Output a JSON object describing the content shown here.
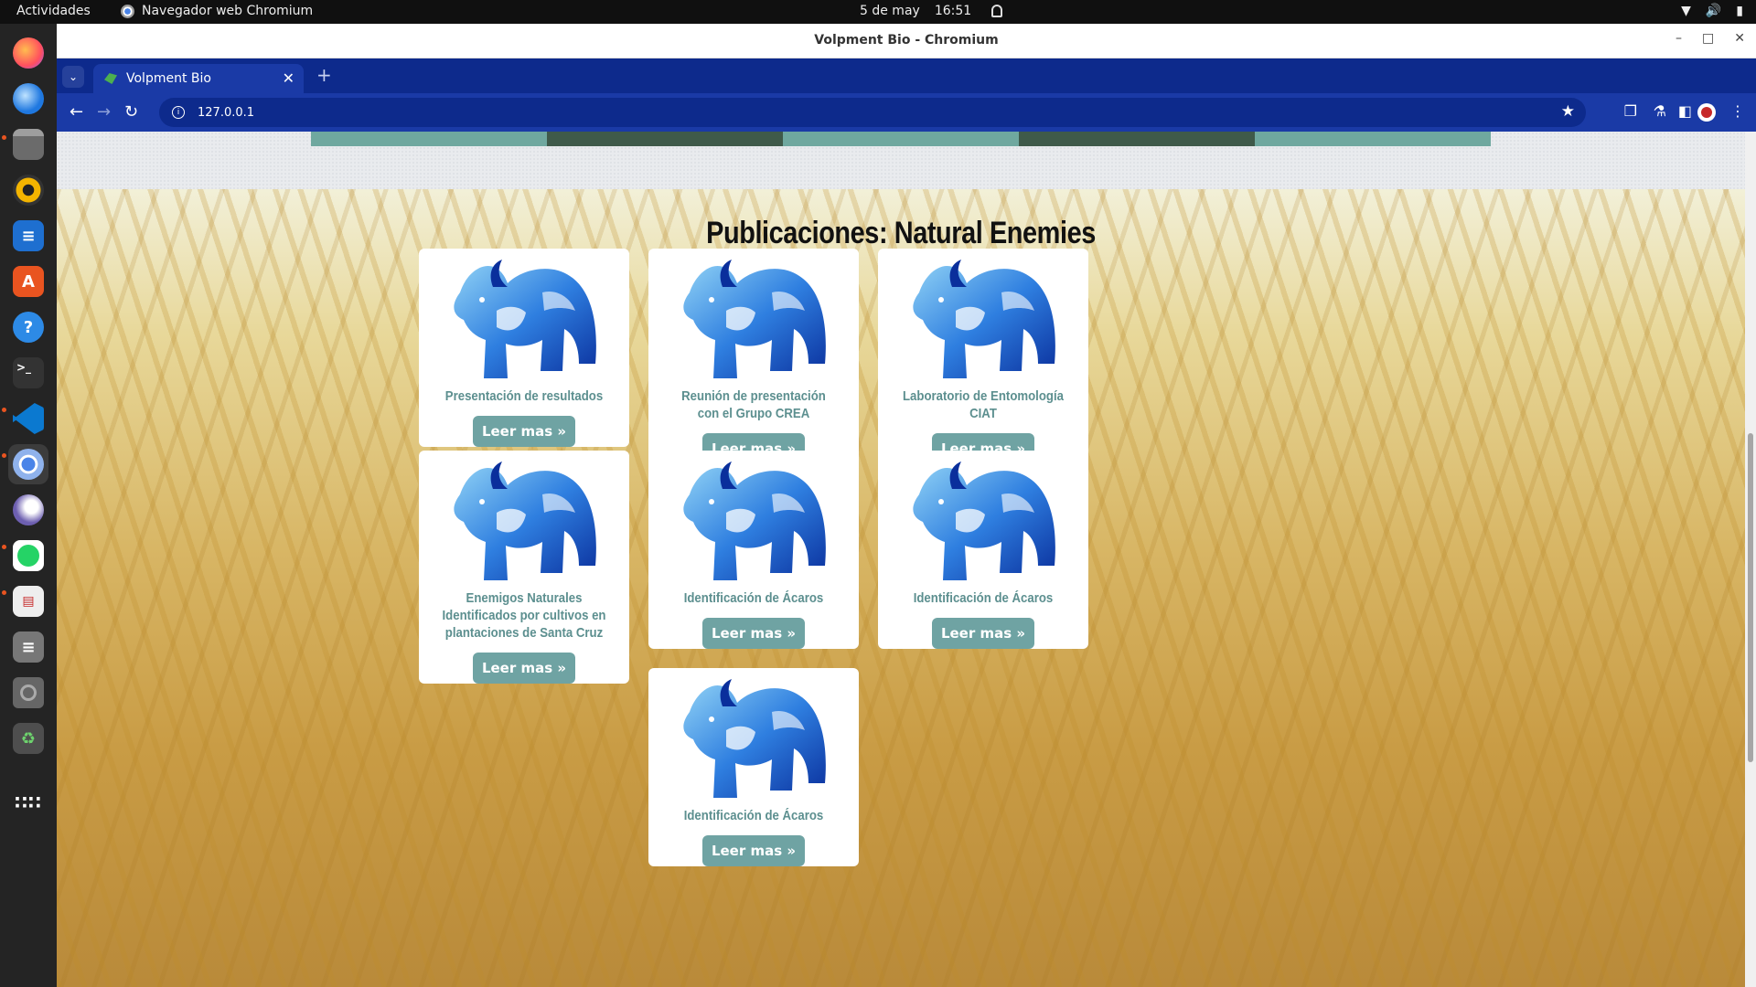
{
  "system_bar": {
    "activities": "Actividades",
    "app_name": "Navegador web Chromium",
    "date": "5 de may",
    "time": "16:51"
  },
  "dock": {
    "items": [
      "firefox-icon",
      "thunderbird-icon",
      "files-icon",
      "rhythmbox-icon",
      "writer-icon",
      "app-center-icon",
      "help-icon",
      "terminal-icon",
      "vscode-icon",
      "chromium-icon",
      "eagle-icon",
      "whatsapp-icon",
      "document-viewer-icon",
      "text-editor-icon",
      "disk-icon",
      "trash-icon",
      "show-apps-icon"
    ]
  },
  "window": {
    "title": "Volpment Bio - Chromium"
  },
  "browser": {
    "tab_title": "Volpment Bio",
    "url": "127.0.0.1"
  },
  "page": {
    "heading": "Publicaciones: Natural Enemies",
    "stripe_colors": [
      "#6fa89f",
      "#3f5a4a",
      "#6fa89f",
      "#3f5a4a",
      "#6fa89f"
    ],
    "button_color": "#6fa3a3",
    "title_color": "#5c8f8f",
    "cards": [
      {
        "title": "Presentación de resultados",
        "button": "Leer mas »"
      },
      {
        "title": "Reunión de presentación con el Grupo CREA",
        "button": "Leer mas »"
      },
      {
        "title": "Laboratorio de Entomología CIAT",
        "button": "Leer mas »"
      },
      {
        "title": "Enemigos Naturales Identificados por cultivos en plantaciones de Santa Cruz",
        "button": "Leer mas »"
      },
      {
        "title": "Identificación de Ácaros",
        "button": "Leer mas »"
      },
      {
        "title": "Identificación de Ácaros",
        "button": "Leer mas »"
      },
      {
        "title": "Identificación de Ácaros",
        "button": "Leer mas »"
      }
    ]
  }
}
